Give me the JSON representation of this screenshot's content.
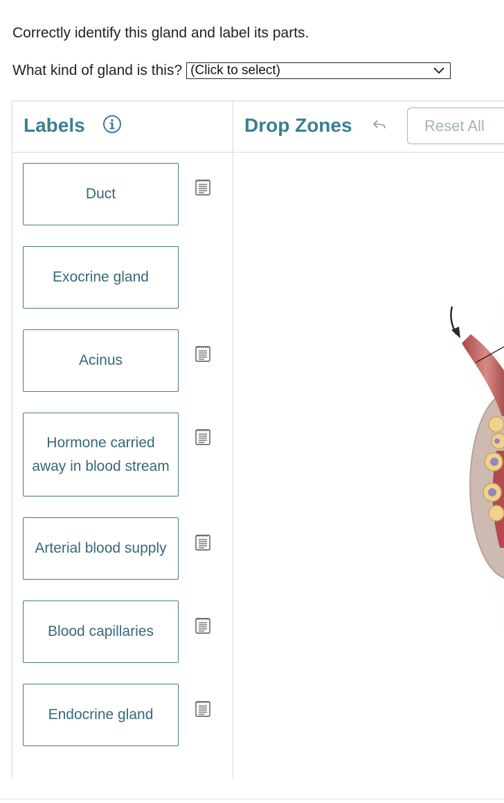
{
  "question": {
    "title": "Correctly identify this gland and label its parts.",
    "prompt": "What kind of gland is this?",
    "select_value": "(Click to select)"
  },
  "labels_panel": {
    "title": "Labels",
    "items": [
      {
        "text": "Duct",
        "has_note": true
      },
      {
        "text": "Exocrine gland",
        "has_note": false
      },
      {
        "text": "Acinus",
        "has_note": true
      },
      {
        "text": "Hormone carried away in blood stream",
        "has_note": true
      },
      {
        "text": "Arterial blood supply",
        "has_note": true
      },
      {
        "text": "Blood capillaries",
        "has_note": true
      },
      {
        "text": "Endocrine gland",
        "has_note": true
      }
    ]
  },
  "drop_zones": {
    "title": "Drop Zones",
    "reset_label": "Reset All"
  },
  "icons": {
    "info": "info-circle-icon",
    "undo": "undo-arrow-icon",
    "note": "notes-icon",
    "chevron": "chevron-down-icon"
  },
  "colors": {
    "accent": "#3a7f8f",
    "card_border": "#3e7a8a",
    "card_text": "#356877"
  }
}
